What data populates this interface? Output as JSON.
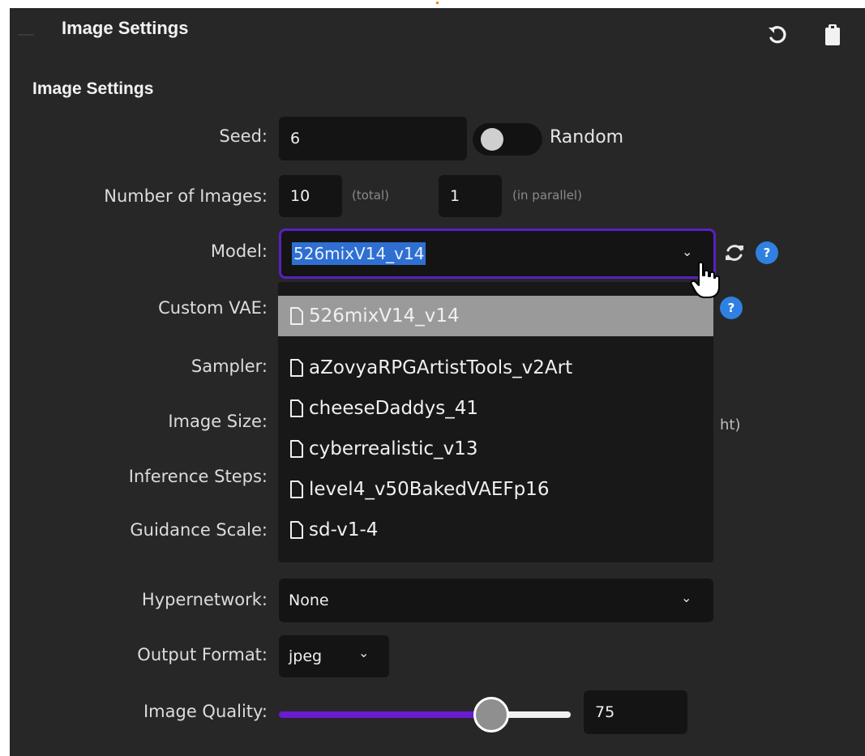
{
  "header": {
    "title": "Image Settings",
    "reset_icon": "undo-icon",
    "clipboard_icon": "clipboard-icon"
  },
  "section_title": "Image Settings",
  "seed": {
    "label": "Seed:",
    "value": "6",
    "random_label": "Random",
    "random_enabled": false
  },
  "num_images": {
    "label": "Number of Images:",
    "total_value": "10",
    "total_hint": "(total)",
    "parallel_value": "1",
    "parallel_hint": "(in parallel)"
  },
  "model": {
    "label": "Model:",
    "selected": "526mixV14_v14",
    "options": [
      "526mixV14_v14",
      "aZovyaRPGArtistTools_v2Art",
      "cheeseDaddys_41",
      "cyberrealistic_v13",
      "level4_v50BakedVAEFp16",
      "sd-v1-4"
    ],
    "highlighted_index": 0
  },
  "custom_vae": {
    "label": "Custom VAE:"
  },
  "sampler": {
    "label": "Sampler:"
  },
  "image_size": {
    "label": "Image Size:",
    "hint_fragment": "ht)"
  },
  "inference_steps": {
    "label": "Inference Steps:"
  },
  "guidance_scale": {
    "label": "Guidance Scale:"
  },
  "hypernetwork": {
    "label": "Hypernetwork:",
    "value": "None"
  },
  "output_format": {
    "label": "Output Format:",
    "value": "jpeg"
  },
  "image_quality": {
    "label": "Image Quality:",
    "value": "75",
    "slider_fraction": 0.75
  },
  "colors": {
    "panel_bg": "#272727",
    "input_bg": "#141414",
    "accent_purple": "#6a1cd0",
    "focus_border": "#5a20c0",
    "help_blue": "#2f80e0",
    "selection_blue": "#2f6fd1"
  }
}
